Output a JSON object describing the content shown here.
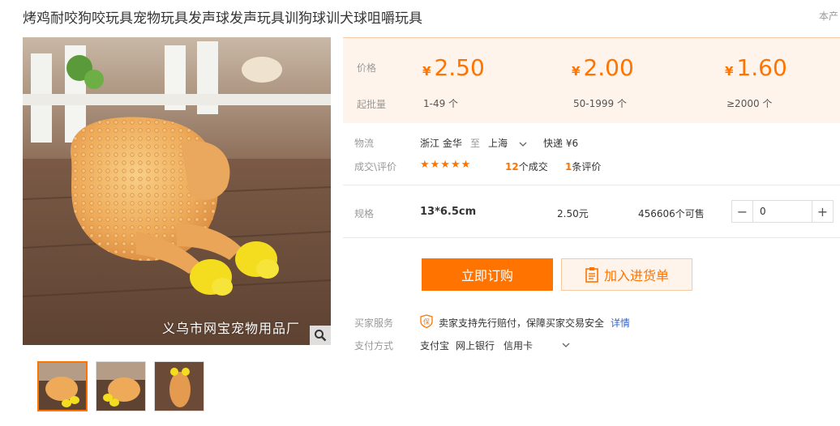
{
  "title": "烤鸡耐咬狗咬玩具宠物玩具发声球发声玩具训狗球训犬球咀嚼玩具",
  "top_right": "本产",
  "image": {
    "watermark": "义乌市网宝宠物用品厂"
  },
  "price": {
    "price_label": "价格",
    "moq_label": "起批量",
    "currency": "¥",
    "tiers": [
      {
        "price": "2.50",
        "range": "1-49 个"
      },
      {
        "price": "2.00",
        "range": "50-1999 个"
      },
      {
        "price": "1.60",
        "range": "≥2000 个"
      }
    ]
  },
  "logistics": {
    "label": "物流",
    "from": "浙江 金华",
    "to_word": "至",
    "to": "上海",
    "express": "快递 ¥6"
  },
  "deals": {
    "label": "成交\\评价",
    "stars": "★★★★★",
    "deal_count": "12",
    "deal_suffix": "个成交",
    "review_count": "1",
    "review_suffix": "条评价"
  },
  "spec": {
    "label": "规格",
    "name": "13*6.5cm",
    "price": "2.50元",
    "stock": "456606个可售",
    "quantity": "0"
  },
  "buttons": {
    "order": "立即订购",
    "cart": "加入进货单"
  },
  "service": {
    "label": "买家服务",
    "badge": "保",
    "text": "卖家支持先行赔付，保障买家交易安全",
    "link": "详情"
  },
  "payment": {
    "label": "支付方式",
    "methods": [
      "支付宝",
      "网上银行",
      "信用卡"
    ]
  },
  "colors": {
    "accent": "#ff7300",
    "price_bg": "#fff4ec",
    "link": "#3366cc"
  }
}
